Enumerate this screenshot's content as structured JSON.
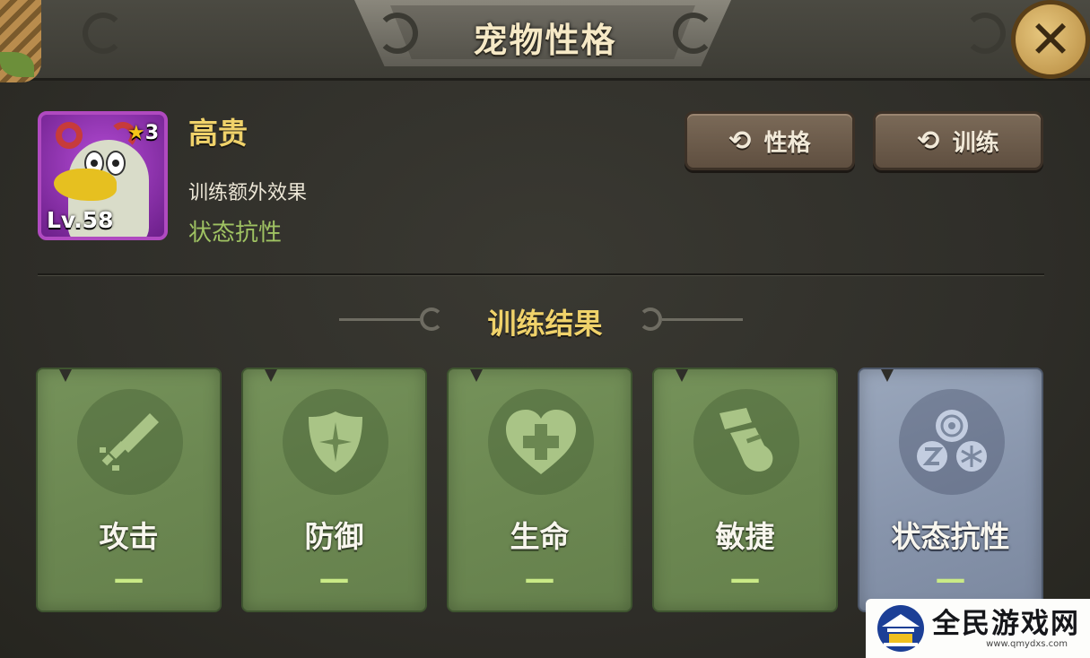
{
  "window": {
    "title": "宠物性格",
    "close_label": "✕"
  },
  "pet": {
    "name": "高贵",
    "stars": "3",
    "level": "Lv.58",
    "extra_effect_label": "训练额外效果",
    "extra_effect_value": "状态抗性"
  },
  "actions": [
    {
      "label": "性格",
      "icon": "refresh-icon"
    },
    {
      "label": "训练",
      "icon": "refresh-icon"
    }
  ],
  "results": {
    "title": "训练结果",
    "stats": [
      {
        "label": "攻击",
        "value": "—",
        "icon": "sword-icon",
        "color": "#6d8a53"
      },
      {
        "label": "防御",
        "value": "—",
        "icon": "shield-icon",
        "color": "#6d8a53"
      },
      {
        "label": "生命",
        "value": "—",
        "icon": "heart-icon",
        "color": "#6d8a53"
      },
      {
        "label": "敏捷",
        "value": "—",
        "icon": "boot-icon",
        "color": "#6d8a53"
      },
      {
        "label": "状态抗性",
        "value": "—",
        "icon": "resistance-icon",
        "color": "#8894ab"
      }
    ]
  },
  "watermark": {
    "name": "全民游戏网",
    "url": "www.qmydxs.com"
  }
}
